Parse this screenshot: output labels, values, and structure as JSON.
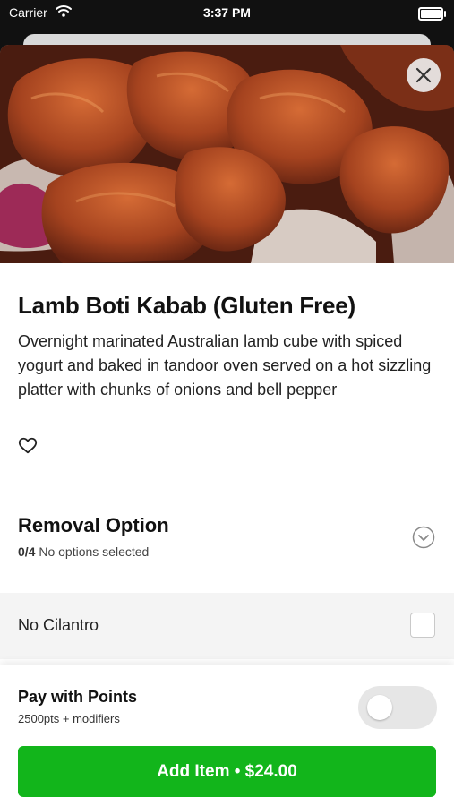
{
  "status_bar": {
    "carrier": "Carrier",
    "time": "3:37 PM"
  },
  "item": {
    "title": "Lamb Boti Kabab (Gluten Free)",
    "description": "Overnight marinated Australian lamb cube with spiced yogurt and baked in tandoor oven served on a hot sizzling platter with chunks of onions and bell pepper",
    "hero_image": "food-photo"
  },
  "removal": {
    "title": "Removal Option",
    "count": "0/4",
    "status": "No options selected",
    "options": [
      {
        "label": "No Cilantro",
        "checked": false
      }
    ]
  },
  "points": {
    "title": "Pay with Points",
    "subtitle": "2500pts + modifiers",
    "enabled": false
  },
  "add_button": {
    "label": "Add Item • $24.00"
  },
  "icons": [
    "wifi-icon",
    "battery-icon",
    "close-icon",
    "heart-icon",
    "chevron-down-icon",
    "checkbox-icon"
  ],
  "colors": {
    "accent": "#12b51b",
    "sheet_background": "#ffffff",
    "option_row_background": "#f4f4f4"
  }
}
